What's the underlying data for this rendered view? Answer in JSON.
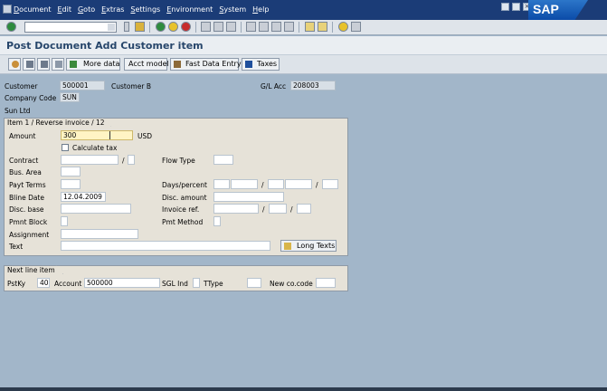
{
  "menu": {
    "items": [
      "Document",
      "Edit",
      "Goto",
      "Extras",
      "Settings",
      "Environment",
      "System",
      "Help"
    ],
    "logo": "SAP"
  },
  "title": "Post Document Add Customer item",
  "app_toolbar": {
    "more_data": "More data",
    "acct_model": "Acct model",
    "fast_data_entry": "Fast Data Entry",
    "taxes": "Taxes"
  },
  "header": {
    "customer_label": "Customer",
    "customer_value": "500001",
    "customer_name": "Customer B",
    "gl_acc_label": "G/L Acc",
    "gl_acc_value": "208003",
    "company_code_label": "Company Code",
    "company_code_value": "SUN",
    "company_name": "Sun Ltd"
  },
  "item_frame": {
    "tab_title": "Item 1 / Reverse invoice / 12",
    "amount_label": "Amount",
    "amount_value": "300",
    "currency": "USD",
    "calculate_tax_label": "Calculate tax",
    "contract_label": "Contract",
    "contract_sep": "/",
    "flow_type_label": "Flow Type",
    "bus_area_label": "Bus. Area",
    "payt_terms_label": "Payt Terms",
    "days_percent_label": "Days/percent",
    "days_sep1": "/",
    "days_sep2": "/",
    "bline_date_label": "Bline Date",
    "bline_date_value": "12.04.2009",
    "disc_amount_label": "Disc. amount",
    "disc_base_label": "Disc. base",
    "invoice_ref_label": "Invoice ref.",
    "inv_sep1": "/",
    "inv_sep2": "/",
    "pmnt_block_label": "Pmnt Block",
    "pmt_method_label": "Pmt Method",
    "assignment_label": "Assignment",
    "text_label": "Text",
    "long_texts_label": "Long Texts"
  },
  "next_line": {
    "tab_title": "Next line item",
    "pstky_label": "PstKy",
    "pstky_value": "40",
    "account_label": "Account",
    "account_value": "500000",
    "sgl_ind_label": "SGL Ind",
    "ttype_label": "TType",
    "new_co_code_label": "New co.code"
  }
}
